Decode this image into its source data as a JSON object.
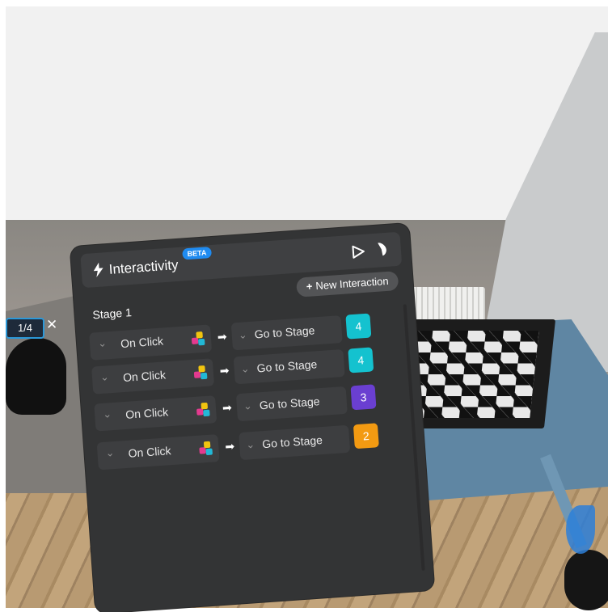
{
  "panel": {
    "title": "Interactivity",
    "beta_label": "BETA",
    "new_interaction_label": "New Interaction",
    "stage_label": "Stage 1",
    "interactions": [
      {
        "trigger": "On Click",
        "action": "Go to Stage",
        "target": "4",
        "color": "#14c2cf"
      },
      {
        "trigger": "On Click",
        "action": "Go to Stage",
        "target": "4",
        "color": "#14c2cf"
      },
      {
        "trigger": "On Click",
        "action": "Go to Stage",
        "target": "3",
        "color": "#6a3fd1"
      },
      {
        "trigger": "On Click",
        "action": "Go to Stage",
        "target": "2",
        "color": "#f39a12"
      }
    ]
  },
  "vr_controls": {
    "slider_value": "1/4",
    "close_symbol": "✕"
  },
  "colors": {
    "beta": "#1f8bf0",
    "panel_bg": "#333435"
  },
  "icons": [
    "bolt-icon",
    "play-icon",
    "pointer-icon",
    "object-cubes-icon",
    "arrow-right-icon",
    "chevron-down-icon"
  ]
}
